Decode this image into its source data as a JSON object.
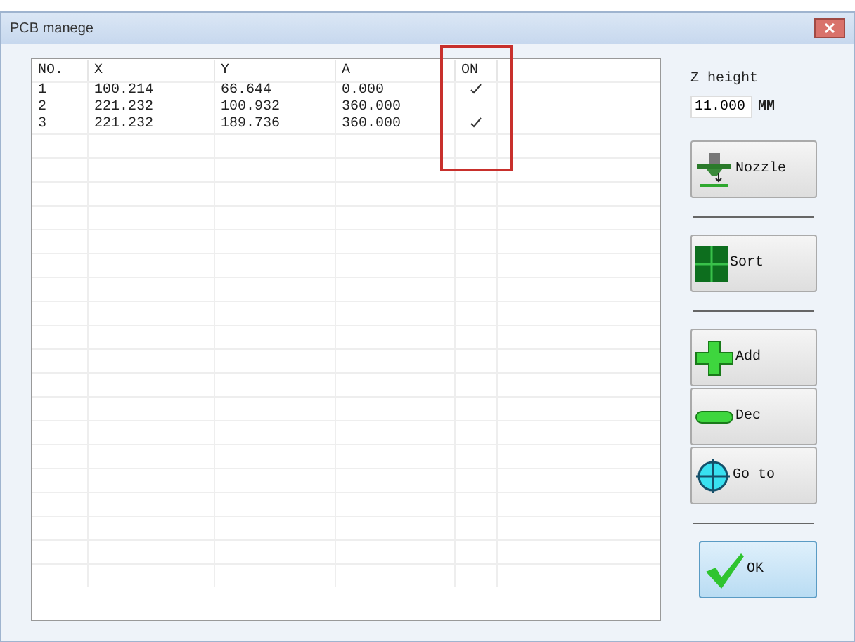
{
  "window": {
    "title": "PCB manege"
  },
  "table": {
    "columns": [
      "NO.",
      "X",
      "Y",
      "A",
      "ON"
    ],
    "rows": [
      {
        "cells": [
          "1",
          "100.214",
          "66.644",
          "0.000"
        ],
        "on": true
      },
      {
        "cells": [
          "2",
          "221.232",
          "100.932",
          "360.000"
        ],
        "on": false
      },
      {
        "cells": [
          "3",
          "221.232",
          "189.736",
          "360.000"
        ],
        "on": true
      }
    ]
  },
  "z_height": {
    "label": "Z height",
    "value": "11.000",
    "unit": "MM"
  },
  "buttons": [
    {
      "kind": "nozzle",
      "label": "Nozzle"
    },
    {
      "kind": "separator"
    },
    {
      "kind": "sort",
      "label": "Sort"
    },
    {
      "kind": "separator"
    },
    {
      "kind": "add",
      "label": "Add"
    },
    {
      "kind": "dec",
      "label": "Dec"
    },
    {
      "kind": "goto",
      "label": "Go to"
    },
    {
      "kind": "separator"
    },
    {
      "kind": "ok",
      "label": "OK"
    }
  ]
}
